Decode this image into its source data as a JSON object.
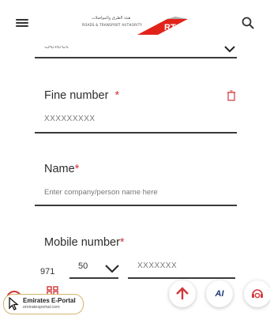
{
  "header": {
    "logo_arabic": "هيئة الطرق والمواصلات",
    "logo_english": "ROADS & TRANSPORT AUTHORITY",
    "logo_mark": "RTA",
    "icons": [
      "menu-icon",
      "search-icon"
    ]
  },
  "form": {
    "select_placeholder": "Select",
    "fine_number": {
      "label": "Fine number",
      "required_mark": "*",
      "placeholder": "XXXXXXXXX"
    },
    "name": {
      "label": "Name",
      "required_mark": "*",
      "placeholder": "Enter company/person name here"
    },
    "mobile": {
      "label": "Mobile number",
      "required_mark": "*",
      "country_code": "971",
      "prefix_value": "50",
      "number_placeholder": "XXXXXXX"
    }
  },
  "bottom": {
    "ai_label": "AI",
    "portal_title": "Emirates E-Portal",
    "portal_url": "emiratesportal.com",
    "icons": [
      "scroll-up-icon",
      "ai-assistant-icon",
      "support-agent-icon",
      "grid-icon",
      "chat-icon"
    ]
  },
  "colors": {
    "accent_red": "#d0373b",
    "line": "#3a3a3a",
    "badge_border": "#d4b36a"
  }
}
